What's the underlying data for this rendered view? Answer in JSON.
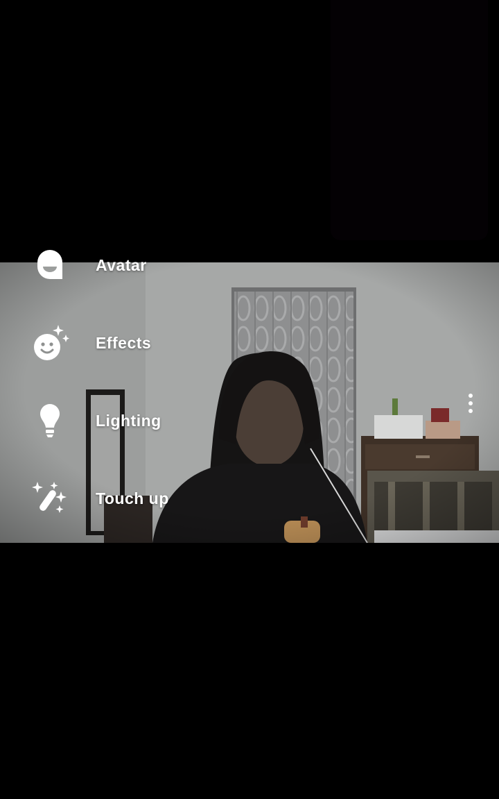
{
  "effects_menu": {
    "items": [
      {
        "label": "Avatar",
        "icon": "avatar-icon"
      },
      {
        "label": "Effects",
        "icon": "sparkle-smiley-icon"
      },
      {
        "label": "Lighting",
        "icon": "lightbulb-icon"
      },
      {
        "label": "Touch up",
        "icon": "magic-wand-icon"
      }
    ]
  },
  "overflow_menu": {
    "icon": "more-vert-icon"
  },
  "colors": {
    "background": "#000000",
    "menu_text": "#ffffff",
    "self_view": "#040104"
  }
}
